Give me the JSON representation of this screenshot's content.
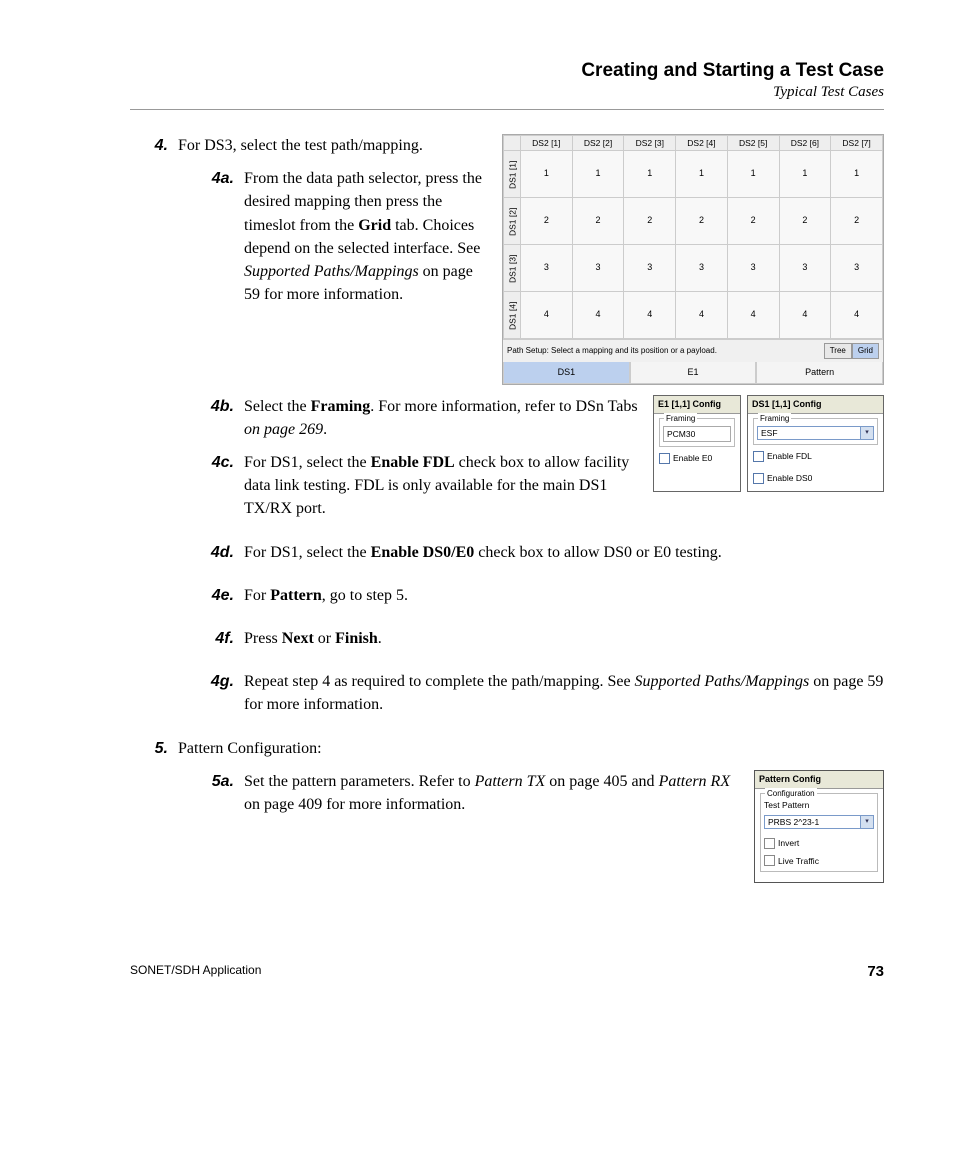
{
  "header": {
    "title": "Creating and Starting a Test Case",
    "subtitle": "Typical Test Cases"
  },
  "step4": {
    "num": "4.",
    "intro": "For DS3, select the test path/mapping.",
    "a": {
      "num": "4a.",
      "t1": "From the data path selector, press the desired mapping then press the timeslot from the ",
      "bold1": "Grid",
      "t2": " tab. Choices depend on the selected interface. See ",
      "it1": "Supported Paths/Mappings",
      "t3": " on page 59 for more information."
    },
    "b": {
      "num": "4b.",
      "t1": "Select the ",
      "bold1": "Framing",
      "t2": ". For more information, refer to DSn Tabs ",
      "it1": "on page 269",
      "t3": "."
    },
    "c": {
      "num": "4c.",
      "t1": "For DS1, select the ",
      "bold1": "Enable FDL",
      "t2": " check box to allow facility data link testing. FDL is only available for the main DS1 TX/RX port."
    },
    "d": {
      "num": "4d.",
      "t1": "For DS1, select the ",
      "bold1": "Enable DS0/E0",
      "t2": " check box to allow DS0 or E0 testing."
    },
    "e": {
      "num": "4e.",
      "t1": "For ",
      "bold1": "Pattern",
      "t2": ", go to step 5."
    },
    "f": {
      "num": "4f.",
      "t1": "Press ",
      "bold1": "Next",
      "t2": " or ",
      "bold2": "Finish",
      "t3": "."
    },
    "g": {
      "num": "4g.",
      "t1": "Repeat step 4 as required to complete the path/mapping. See ",
      "it1": "Supported Paths/Mappings",
      "t2": " on page 59 for more information."
    }
  },
  "step5": {
    "num": "5.",
    "intro": "Pattern Configuration:",
    "a": {
      "num": "5a.",
      "t1": "Set the pattern parameters. Refer to ",
      "it1": "Pattern TX",
      "t2": " on page 405 and ",
      "it2": "Pattern RX",
      "t3": " on page 409 for more information."
    }
  },
  "grid_fig": {
    "cols": [
      "DS2 [1]",
      "DS2 [2]",
      "DS2 [3]",
      "DS2 [4]",
      "DS2 [5]",
      "DS2 [6]",
      "DS2 [7]"
    ],
    "rows": [
      "DS1 [1]",
      "DS1 [2]",
      "DS1 [3]",
      "DS1 [4]"
    ],
    "cells": [
      [
        "1",
        "1",
        "1",
        "1",
        "1",
        "1",
        "1"
      ],
      [
        "2",
        "2",
        "2",
        "2",
        "2",
        "2",
        "2"
      ],
      [
        "3",
        "3",
        "3",
        "3",
        "3",
        "3",
        "3"
      ],
      [
        "4",
        "4",
        "4",
        "4",
        "4",
        "4",
        "4"
      ]
    ],
    "status": "Path Setup: Select a mapping and its position or a payload.",
    "btn_tree": "Tree",
    "btn_grid": "Grid",
    "tabs": [
      "DS1",
      "E1",
      "Pattern"
    ]
  },
  "e1cfg": {
    "title": "E1  [1,1] Config",
    "framing_label": "Framing",
    "framing_value": "PCM30",
    "chk": "Enable E0"
  },
  "ds1cfg": {
    "title": "DS1  [1,1] Config",
    "framing_label": "Framing",
    "framing_value": "ESF",
    "chk1": "Enable FDL",
    "chk2": "Enable DS0"
  },
  "patterncfg": {
    "title": "Pattern Config",
    "group": "Configuration",
    "label": "Test Pattern",
    "value": "PRBS 2^23-1",
    "chk1": "Invert",
    "chk2": "Live Traffic"
  },
  "footer": {
    "app": "SONET/SDH Application",
    "page": "73"
  }
}
